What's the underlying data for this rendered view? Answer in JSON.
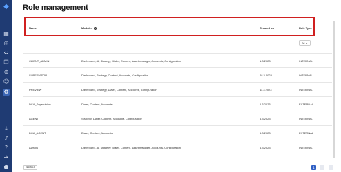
{
  "page": {
    "title": "Role management"
  },
  "sidebar": {
    "icons": [
      "dashboard-icon",
      "globe-icon",
      "arrows-icon",
      "copy-icon",
      "web-icon",
      "users-icon",
      "settings-icon",
      "download-icon",
      "bell-icon",
      "help-icon",
      "logout-icon",
      "profile-icon"
    ]
  },
  "table": {
    "columns": {
      "name": "Name",
      "modules": "Modules",
      "created_on": "Created on",
      "role_type": "Role Type"
    },
    "filter_value": "All",
    "rows": [
      {
        "name": "CLIENT_ADMIN",
        "modules": "Dashboard, AI, Strategy, Dialer, Content, Asset manager, Accounts, Configuration",
        "created_on": "1.3.2023",
        "role_type": "INTERNAL"
      },
      {
        "name": "SUPERVISOR",
        "modules": "Dashboard, Strategy, Content, Accounts, Configuration",
        "created_on": "28.3.2023",
        "role_type": "INTERNAL"
      },
      {
        "name": "PREVIEW",
        "modules": "Dashboard, Strategy, Dialer, Content, Accounts, Configuration",
        "created_on": "11.3.2023",
        "role_type": "INTERNAL"
      },
      {
        "name": "DCA_Supervision",
        "modules": "Dialer, Content, Accounts",
        "created_on": "6.3.2023",
        "role_type": "EXTERNAL"
      },
      {
        "name": "AGENT",
        "modules": "Strategy, Dialer, Content, Accounts, Configuration",
        "created_on": "6.3.2023",
        "role_type": "INTERNAL"
      },
      {
        "name": "DCA_AGENT",
        "modules": "Dialer, Content, Accounts",
        "created_on": "6.3.2023",
        "role_type": "EXTERNAL"
      },
      {
        "name": "ADMIN",
        "modules": "Dashboard, AI, Strategy, Dialer, Content, Asset manager, Accounts, Configuration",
        "created_on": "6.3.2023",
        "role_type": "INTERNAL"
      }
    ]
  },
  "footer": {
    "show_label": "Show 15",
    "current_page": "1"
  }
}
